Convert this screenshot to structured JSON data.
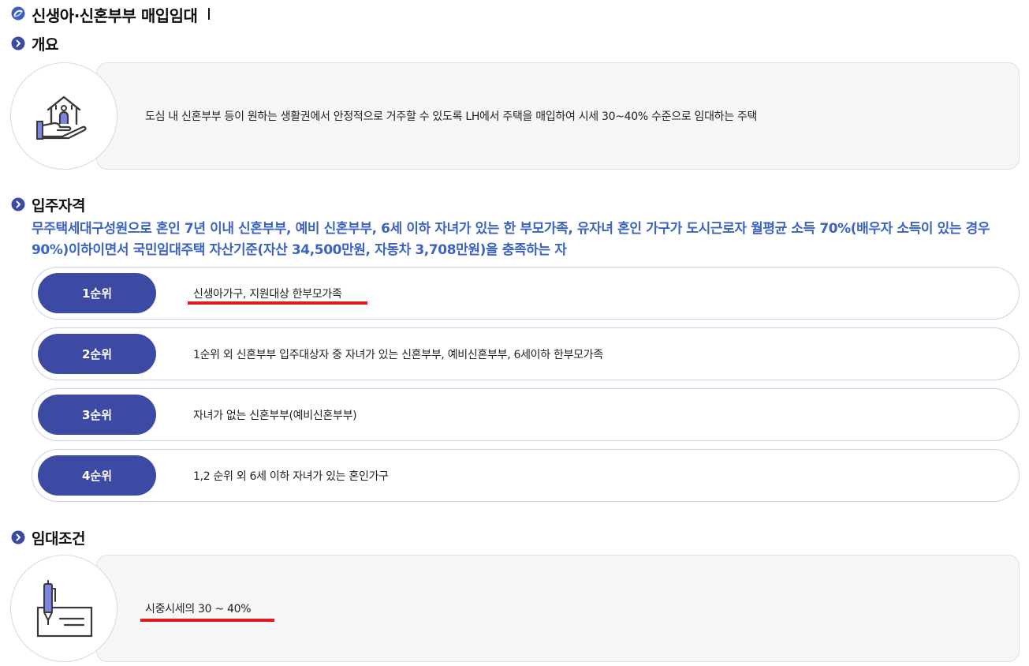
{
  "page": {
    "title": "신생아·신혼부부 매입임대"
  },
  "overview": {
    "heading": "개요",
    "icon": "house-in-hand-icon",
    "text": "도심 내 신혼부부 등이 원하는 생활권에서 안정적으로 거주할 수 있도록 LH에서 주택을 매입하여 시세 30~40% 수준으로 임대하는 주택"
  },
  "qualification": {
    "heading": "입주자격",
    "lead": "무주택세대구성원으로 혼인 7년 이내 신혼부부, 예비 신혼부부, 6세 이하 자녀가 있는 한 부모가족, 유자녀 혼인 가구가 도시근로자 월평균 소득 70%(배우자 소득이 있는 경우 90%)이하이면서 국민임대주택 자산기준(자산 34,500만원, 자동차 3,708만원)을 충족하는 자",
    "ranks": [
      {
        "label": "1순위",
        "text": "신생아가구, 지원대상 한부모가족"
      },
      {
        "label": "2순위",
        "text": "1순위 외 신혼부부 입주대상자 중 자녀가 있는 신혼부부, 예비신혼부부, 6세이하 한부모가족"
      },
      {
        "label": "3순위",
        "text": "자녀가 없는 신혼부부(예비신혼부부)"
      },
      {
        "label": "4순위",
        "text": "1,2 순위 외 6세 이하 자녀가 있는 혼인가구"
      }
    ]
  },
  "lease": {
    "heading": "임대조건",
    "icon": "pen-and-check-icon",
    "text": "시중시세의 30 ~ 40%"
  },
  "colors": {
    "accent_blue": "#3c63c4",
    "pill_navy": "#3d4aa3",
    "highlight_red": "#e21a1a",
    "card_bg": "#f5f6f8"
  }
}
